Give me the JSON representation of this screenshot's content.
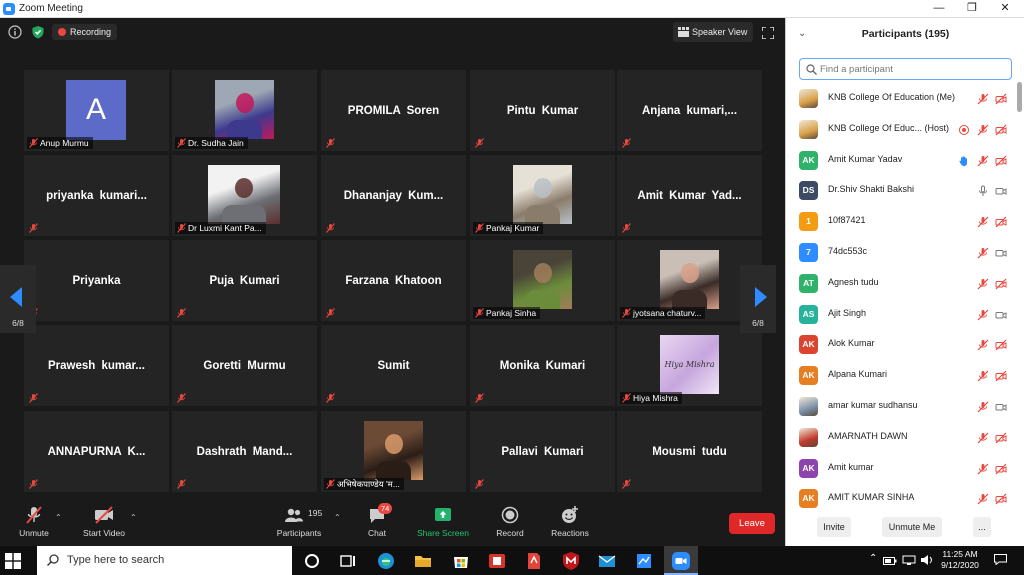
{
  "window": {
    "title": "Zoom Meeting"
  },
  "top": {
    "recording_label": "Recording",
    "speaker_view_label": "Speaker View"
  },
  "grid": {
    "page_indicator": "6/8",
    "tiles": [
      [
        "Anup Murmu",
        "Dr. Sudha Jain",
        "PROMILA Soren",
        "Pintu Kumar",
        "Anjana  kumari,..."
      ],
      [
        "priyanka  kumari...",
        "Dr Luxmi Kant Pa...",
        "Dhananjay  Kum...",
        "Pankaj Kumar",
        "Amit Kumar Yad..."
      ],
      [
        "Priyanka",
        "Puja Kumari",
        "Farzana Khatoon",
        "Pankaj Sinha",
        "jyotsana chaturv..."
      ],
      [
        "Prawesh  kumar...",
        "Goretti Murmu",
        "Sumit",
        "Monika Kumari",
        "Hiya Mishra"
      ],
      [
        "ANNAPURNA  K...",
        "Dashrath  Mand...",
        "अभिषेकपाण्डेय 'म...",
        "Pallavi Kumari",
        "Mousmi tudu"
      ]
    ],
    "avatar_letter": "A",
    "hiya_card_text": "Hiya Mishra"
  },
  "toolbar": {
    "unmute": "Unmute",
    "start_video": "Start Video",
    "participants": "Participants",
    "participant_count": "195",
    "chat": "Chat",
    "chat_badge": "74",
    "share_screen": "Share Screen",
    "record": "Record",
    "reactions": "Reactions",
    "leave": "Leave"
  },
  "panel": {
    "title": "Participants (195)",
    "search_placeholder": "Find a participant",
    "participants": [
      {
        "name": "KNB College Of Education (Me)",
        "initials": "",
        "color": "#d9a04a"
      },
      {
        "name": "KNB College Of Educ... (Host)",
        "initials": "",
        "color": "#d9a04a"
      },
      {
        "name": "Amit Kumar Yadav",
        "initials": "AK",
        "color": "#2fb36a"
      },
      {
        "name": "Dr.Shiv Shakti Bakshi",
        "initials": "DS",
        "color": "#3c4a63"
      },
      {
        "name": "10f87421",
        "initials": "1",
        "color": "#f39c12"
      },
      {
        "name": "74dc553c",
        "initials": "7",
        "color": "#2d8cff"
      },
      {
        "name": "Agnesh tudu",
        "initials": "AT",
        "color": "#2fb36a"
      },
      {
        "name": "Ajit Singh",
        "initials": "AS",
        "color": "#27b39b"
      },
      {
        "name": "Alok Kumar",
        "initials": "AK",
        "color": "#d9452e"
      },
      {
        "name": "Alpana Kumari",
        "initials": "AK",
        "color": "#e67e22"
      },
      {
        "name": "amar kumar sudhansu",
        "initials": "",
        "color": "#7a8fa8"
      },
      {
        "name": "AMARNATH DAWN",
        "initials": "",
        "color": "#c0392b"
      },
      {
        "name": "Amit kumar",
        "initials": "AK",
        "color": "#8e44ad"
      },
      {
        "name": "AMIT KUMAR SINHA",
        "initials": "AK",
        "color": "#e67e22"
      }
    ],
    "invite": "Invite",
    "unmute_me": "Unmute Me",
    "more": "..."
  },
  "taskbar": {
    "search_placeholder": "Type here to search",
    "time": "11:25 AM",
    "date": "9/12/2020"
  }
}
